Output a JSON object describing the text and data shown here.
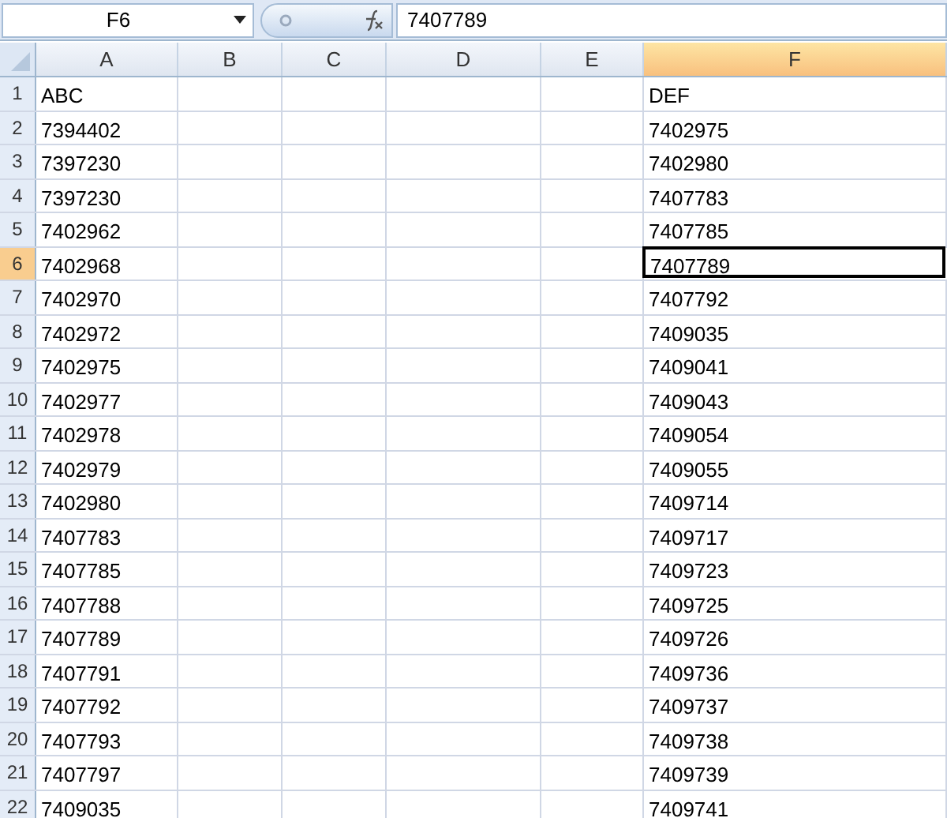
{
  "formula_bar": {
    "name_box": "F6",
    "formula": "7407789"
  },
  "columns": [
    {
      "label": "A",
      "selected": false
    },
    {
      "label": "B",
      "selected": false
    },
    {
      "label": "C",
      "selected": false
    },
    {
      "label": "D",
      "selected": false
    },
    {
      "label": "E",
      "selected": false
    },
    {
      "label": "F",
      "selected": true
    }
  ],
  "rows": [
    {
      "header": "1",
      "selected": false,
      "active": false,
      "a": "ABC",
      "f": "DEF"
    },
    {
      "header": "2",
      "selected": false,
      "active": false,
      "a": "7394402",
      "f": "7402975"
    },
    {
      "header": "3",
      "selected": false,
      "active": false,
      "a": "7397230",
      "f": "7402980"
    },
    {
      "header": "4",
      "selected": false,
      "active": false,
      "a": "7397230",
      "f": "7407783"
    },
    {
      "header": "5",
      "selected": false,
      "active": false,
      "a": "7402962",
      "f": "7407785"
    },
    {
      "header": "6",
      "selected": true,
      "active": true,
      "a": "7402968",
      "f": "7407789"
    },
    {
      "header": "7",
      "selected": false,
      "active": false,
      "a": "7402970",
      "f": "7407792"
    },
    {
      "header": "8",
      "selected": false,
      "active": false,
      "a": "7402972",
      "f": "7409035"
    },
    {
      "header": "9",
      "selected": false,
      "active": false,
      "a": "7402975",
      "f": "7409041"
    },
    {
      "header": "10",
      "selected": false,
      "active": false,
      "a": "7402977",
      "f": "7409043"
    },
    {
      "header": "11",
      "selected": false,
      "active": false,
      "a": "7402978",
      "f": "7409054"
    },
    {
      "header": "12",
      "selected": false,
      "active": false,
      "a": "7402979",
      "f": "7409055"
    },
    {
      "header": "13",
      "selected": false,
      "active": false,
      "a": "7402980",
      "f": "7409714"
    },
    {
      "header": "14",
      "selected": false,
      "active": false,
      "a": "7407783",
      "f": "7409717"
    },
    {
      "header": "15",
      "selected": false,
      "active": false,
      "a": "7407785",
      "f": "7409723"
    },
    {
      "header": "16",
      "selected": false,
      "active": false,
      "a": "7407788",
      "f": "7409725"
    },
    {
      "header": "17",
      "selected": false,
      "active": false,
      "a": "7407789",
      "f": "7409726"
    },
    {
      "header": "18",
      "selected": false,
      "active": false,
      "a": "7407791",
      "f": "7409736"
    },
    {
      "header": "19",
      "selected": false,
      "active": false,
      "a": "7407792",
      "f": "7409737"
    },
    {
      "header": "20",
      "selected": false,
      "active": false,
      "a": "7407793",
      "f": "7409738"
    },
    {
      "header": "21",
      "selected": false,
      "active": false,
      "a": "7407797",
      "f": "7409739"
    },
    {
      "header": "22",
      "selected": false,
      "active": false,
      "a": "7409035",
      "f": "7409741"
    }
  ]
}
